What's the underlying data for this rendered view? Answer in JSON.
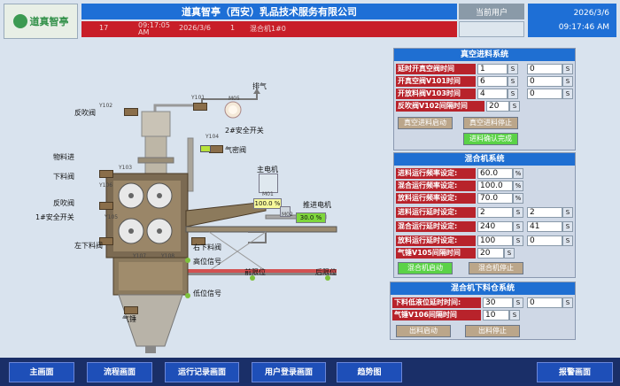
{
  "header": {
    "logo_text": "道真智亭",
    "title": "道真智亭（西安）乳品技术服务有限公司",
    "user_label": "当前用户",
    "user_value": "",
    "date": "2026/3/6",
    "time": "09:17:46 AM"
  },
  "alarm": {
    "number": "17",
    "time": "09:17:05 AM",
    "date": "2026/3/6",
    "separator": "1",
    "message": "混合机1#0"
  },
  "process": {
    "labels": {
      "exhaust": "排气",
      "blowback_valve_top": "反吹阀",
      "safety_switch_2": "2#安全开关",
      "seal_valve": "气密阀",
      "material_inlet": "物料进",
      "lower_valve": "下料阀",
      "blowback_valve_mid": "反吹阀",
      "safety_switch_1": "1#安全开关",
      "main_motor": "主电机",
      "push_motor": "推进电机",
      "left_lower_valve": "左下料阀",
      "right_lower_valve": "右下料阀",
      "high_level": "高位信号",
      "low_level": "低位信号",
      "front_limit": "前限位",
      "rear_limit": "后限位",
      "air_hammer": "气锤"
    },
    "tags": {
      "y102": "Y102",
      "y101": "Y101",
      "m05": "M05",
      "y104": "Y104",
      "y106": "Y106",
      "y103": "Y103",
      "y105": "Y105",
      "y107": "Y107",
      "y108": "Y108",
      "m01": "M01",
      "m02": "M02"
    },
    "main_motor_freq": "100.0 %",
    "push_motor_freq": "30.0 %"
  },
  "vacuum": {
    "title": "真空进料系统",
    "rows": [
      {
        "label": "延时开真空阀时间",
        "v1": "1",
        "u1": "S",
        "v2": "0",
        "u2": "S"
      },
      {
        "label": "开真空阀V101时间",
        "v1": "6",
        "u1": "S",
        "v2": "0",
        "u2": "S"
      },
      {
        "label": "开放料阀V103时间",
        "v1": "4",
        "u1": "S",
        "v2": "0",
        "u2": "S"
      },
      {
        "label": "反吹阀V102间隔时间",
        "v1": "20",
        "u1": "S"
      }
    ],
    "btn_start": "真空进料启动",
    "btn_stop": "真空进料停止",
    "btn_confirm": "进料确认完成"
  },
  "mixer": {
    "title": "混合机系统",
    "rows": [
      {
        "label": "进料运行频率设定:",
        "v1": "60.0",
        "u1": "%"
      },
      {
        "label": "混合运行频率设定:",
        "v1": "100.0",
        "u1": "%"
      },
      {
        "label": "放料运行频率设定:",
        "v1": "70.0",
        "u1": "%"
      },
      {
        "label": "进料运行延时设定:",
        "v1": "2",
        "u1": "S",
        "v2": "2",
        "u2": "S"
      },
      {
        "label": "混合运行延时设定:",
        "v1": "240",
        "u1": "S",
        "v2": "41",
        "u2": "S"
      },
      {
        "label": "放料运行延时设定:",
        "v1": "100",
        "u1": "S",
        "v2": "0",
        "u2": "S"
      },
      {
        "label": "气锤V105间隔时间",
        "v1": "20",
        "u1": "S"
      }
    ],
    "btn_start": "混合机启动",
    "btn_stop": "混合机停止"
  },
  "bin": {
    "title": "混合机下料仓系统",
    "rows": [
      {
        "label": "下料低液位延时时间:",
        "v1": "30",
        "u1": "S",
        "v2": "0",
        "u2": "S"
      },
      {
        "label": "气锤V106间隔时间",
        "v1": "10",
        "u1": "S"
      }
    ],
    "btn_start": "出料启动",
    "btn_stop": "出料停止"
  },
  "nav": {
    "main": "主画面",
    "flow": "流程画面",
    "runlog": "运行记录画面",
    "userlogin": "用户登录画面",
    "trend": "趋势图",
    "alarm": "报警画面"
  },
  "colors": {
    "title_blue": "#1e6fd6",
    "alarm_red": "#c81e28",
    "label_red": "#b8232b",
    "active_green": "#5bd247",
    "button_tan": "#bba68a"
  }
}
